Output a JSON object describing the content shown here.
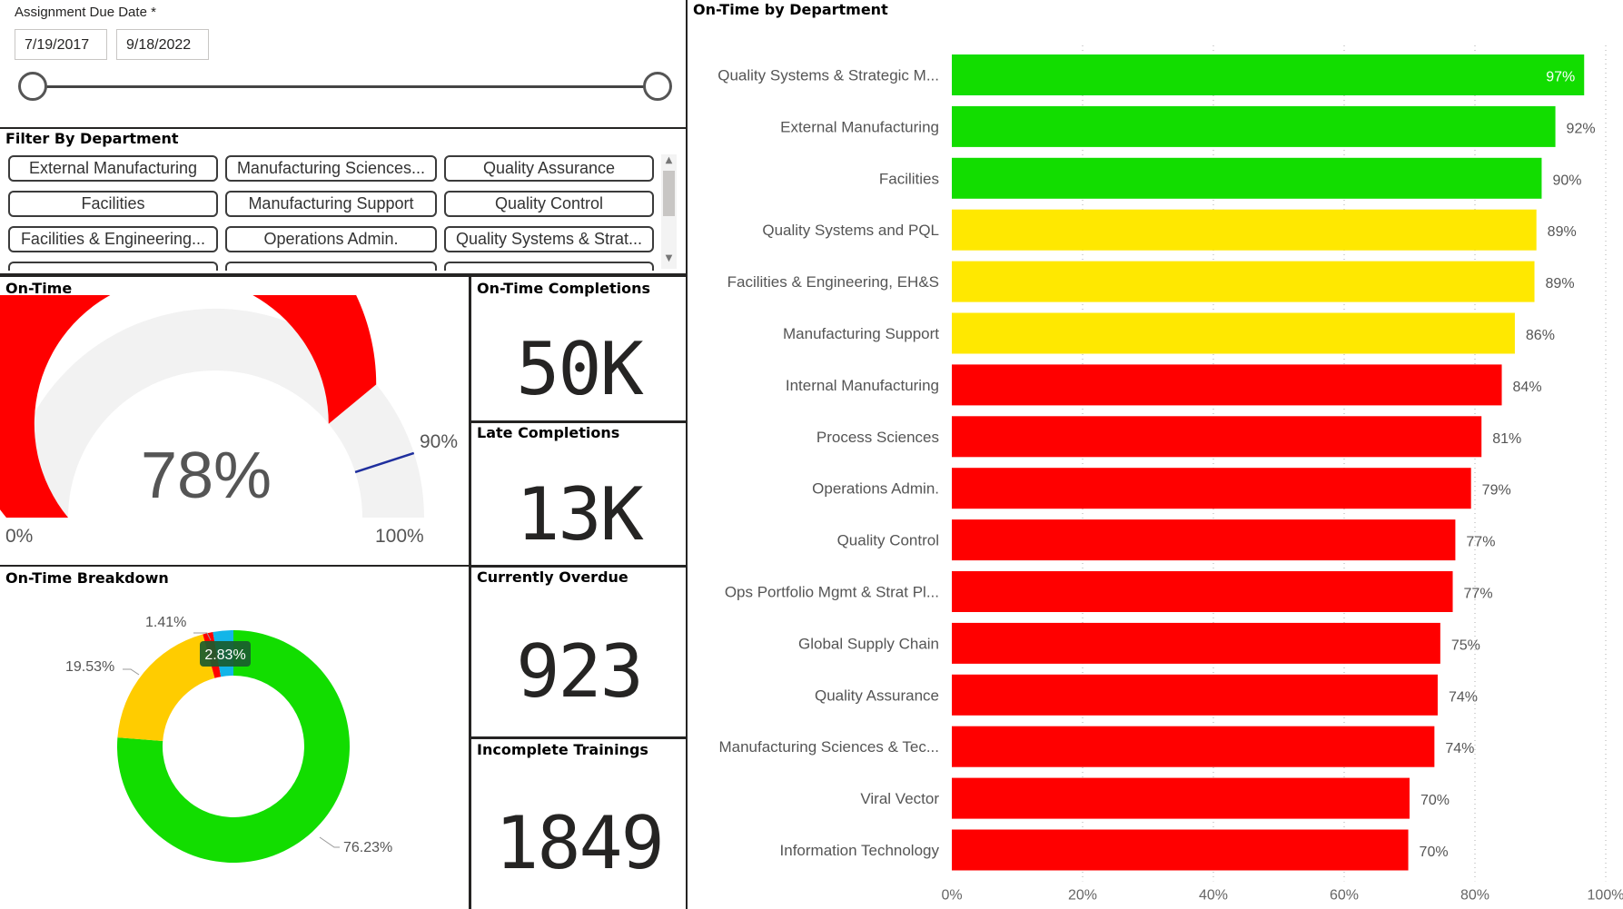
{
  "date_slicer": {
    "title": "Assignment Due Date *",
    "start": "7/19/2017",
    "end": "9/18/2022"
  },
  "filter": {
    "title": "Filter By Department",
    "tiles": [
      "External Manufacturing",
      "Manufacturing Sciences...",
      "Quality Assurance",
      "Facilities",
      "Manufacturing Support",
      "Quality Control",
      "Facilities & Engineering...",
      "Operations Admin.",
      "Quality Systems & Strat..."
    ]
  },
  "gauge": {
    "title": "On-Time",
    "value": 78,
    "value_label": "78%",
    "target": 90,
    "target_label": "90%",
    "min_label": "0%",
    "max_label": "100%",
    "fill_color": "#ff0000",
    "track_color": "#f2f2f2",
    "target_color": "#1f2f9e"
  },
  "cards": {
    "on_time_completions": {
      "title": "On-Time Completions",
      "value": "50K"
    },
    "late_completions": {
      "title": "Late Completions",
      "value": "13K"
    },
    "currently_overdue": {
      "title": "Currently Overdue",
      "value": "923"
    },
    "incomplete_trainings": {
      "title": "Incomplete Trainings",
      "value": "1849"
    }
  },
  "breakdown": {
    "title": "On-Time Breakdown",
    "chart_data": {
      "type": "pie",
      "slices": [
        {
          "value": 76.23,
          "label": "76.23%",
          "color": "#12dd00"
        },
        {
          "value": 19.53,
          "label": "19.53%",
          "color": "#ffcc00"
        },
        {
          "value": 1.41,
          "label": "1.41%",
          "color": "#ff0000"
        },
        {
          "value": 2.83,
          "label": "2.83%",
          "color": "#12b5e8"
        }
      ]
    }
  },
  "department_chart": {
    "title": "On-Time by Department",
    "chart_data": {
      "type": "bar",
      "orientation": "horizontal",
      "categories": [
        "Quality Systems & Strategic M...",
        "External Manufacturing",
        "Facilities",
        "Quality Systems and PQL",
        "Facilities & Engineering, EH&S",
        "Manufacturing Support",
        "Internal Manufacturing",
        "Process Sciences",
        "Operations Admin.",
        "Quality Control",
        "Ops Portfolio Mgmt & Strat Pl...",
        "Global Supply Chain",
        "Quality Assurance",
        "Manufacturing Sciences & Tec...",
        "Viral Vector",
        "Information Technology"
      ],
      "values": [
        96.7,
        92.3,
        90.2,
        89.4,
        89.1,
        86.1,
        84.1,
        81.0,
        79.4,
        77.0,
        76.6,
        74.7,
        74.3,
        73.8,
        70.0,
        69.8
      ],
      "labels": [
        "97%",
        "92%",
        "90%",
        "89%",
        "89%",
        "86%",
        "84%",
        "81%",
        "79%",
        "77%",
        "77%",
        "75%",
        "74%",
        "74%",
        "70%",
        "70%"
      ],
      "colors": [
        "#12dd00",
        "#12dd00",
        "#12dd00",
        "#ffe800",
        "#ffe800",
        "#ffe800",
        "#ff0000",
        "#ff0000",
        "#ff0000",
        "#ff0000",
        "#ff0000",
        "#ff0000",
        "#ff0000",
        "#ff0000",
        "#ff0000",
        "#ff0000"
      ],
      "xlim": [
        0,
        100
      ],
      "xticks": [
        "0%",
        "20%",
        "40%",
        "60%",
        "80%",
        "100%"
      ],
      "grid": "vertical dotted"
    }
  }
}
